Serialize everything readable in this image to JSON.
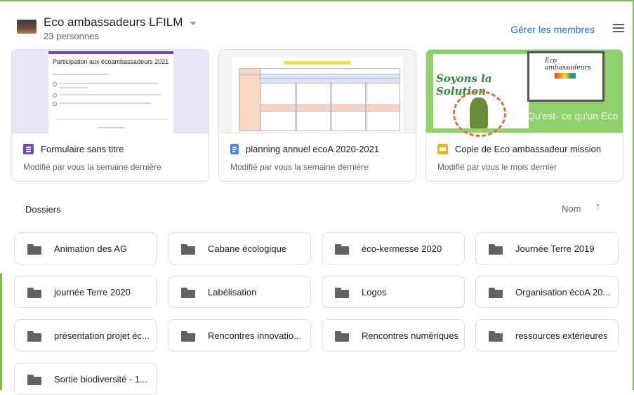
{
  "header": {
    "group_title": "Eco ambassadeurs LFILM",
    "member_count": "23 personnes",
    "manage_label": "Gérer les membres"
  },
  "cards": [
    {
      "name": "Formulaire sans titre",
      "modified": "Modifié par vous la semaine dernière",
      "icon": "forms-icon",
      "icon_color": "#7248b9",
      "preview_title": "Participation aux écoambassadeurs 2021"
    },
    {
      "name": "planning annuel ecoA 2020-2021",
      "modified": "Modifié par vous la semaine dernière",
      "icon": "docs-icon",
      "icon_color": "#4285f4"
    },
    {
      "name": "Copie de Eco ambassadeur mission",
      "modified": "Modifié par vous le mois dernier",
      "icon": "slides-icon",
      "icon_color": "#f4b400",
      "preview_title": "Soyons la Solution",
      "preview_logo": "Eco ambassadeurs",
      "preview_question": "Qu'est- ce qu'un Eco"
    }
  ],
  "folders_section": {
    "label": "Dossiers",
    "sort_label": "Nom",
    "sort_arrow": "↑"
  },
  "folders": [
    "Animation des AG",
    "Cabane écologique",
    "éco-kermesse 2020",
    "Journée Terre 2019",
    "journée Terre 2020",
    "Labélisation",
    "Logos",
    "Organisation écoA 20...",
    "présentation projet éc...",
    "Rencontres innovatio...",
    "Rencontres numériques",
    "ressources extérieures",
    "Sortie biodiversité - 1..."
  ],
  "colors": {
    "accent": "#1a73e8",
    "frame_green": "#7cc04a"
  }
}
